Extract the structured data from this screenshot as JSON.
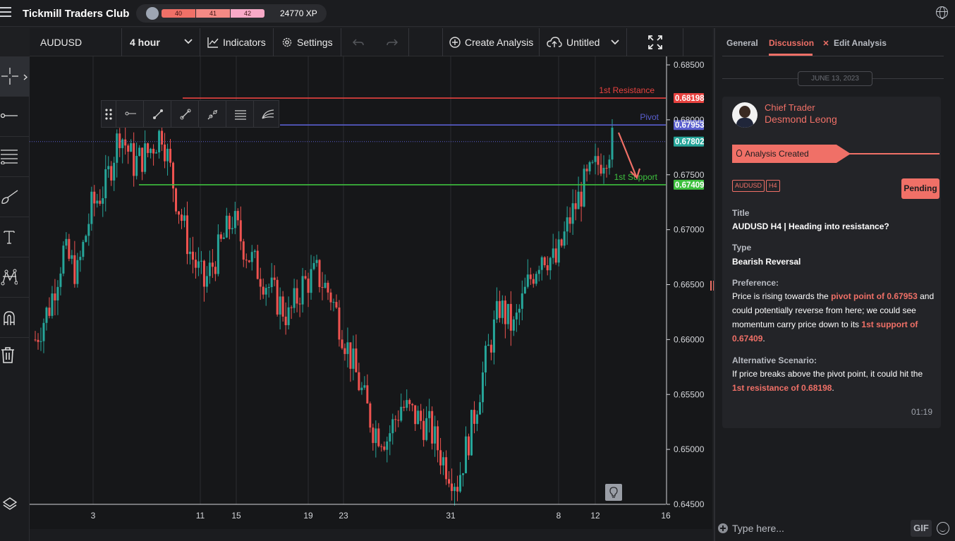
{
  "app": {
    "brand": "Tickmill Traders Club",
    "xp_levels": [
      "40",
      "41",
      "42"
    ],
    "xp_total": "24770 XP",
    "menu_icon": "hamburger-icon",
    "globe_icon": "globe-icon"
  },
  "toolbar": {
    "symbol": "AUDUSD",
    "interval": "4 hour",
    "indicators": "Indicators",
    "settings": "Settings",
    "create_analysis": "Create Analysis",
    "layout_name": "Untitled"
  },
  "left_tools": [
    "crosshair-icon",
    "horizontal-line-icon",
    "fib-lines-icon",
    "brush-icon",
    "text-icon",
    "pattern-icon",
    "magnet-icon",
    "trash-icon",
    "layers-icon"
  ],
  "chart_data": {
    "type": "candlestick",
    "symbol": "AUDUSD",
    "interval": "4 hour",
    "x_ticks": [
      "3",
      "11",
      "15",
      "19",
      "23",
      "31",
      "8",
      "12",
      "16"
    ],
    "y_ticks": [
      "0.68500",
      "0.68000",
      "0.67500",
      "0.67000",
      "0.66500",
      "0.66000",
      "0.65500",
      "0.65000",
      "0.64500"
    ],
    "ylim": [
      0.645,
      0.685
    ],
    "horizontal_levels": [
      {
        "label": "1st Resistance",
        "value": "0.68198",
        "color": "#e8423f"
      },
      {
        "label": "Pivot",
        "value": "0.67953",
        "color": "#5a5fd0"
      },
      {
        "label": "",
        "value": "0.67802",
        "color": "#26a69a"
      },
      {
        "label": "1st Support",
        "value": "0.67409",
        "color": "#3ec13e"
      }
    ],
    "up_color": "#26a69a",
    "down_color": "#ef5350",
    "close_approx": [
      0.66,
      0.663,
      0.668,
      0.666,
      0.672,
      0.674,
      0.679,
      0.676,
      0.677,
      0.679,
      0.673,
      0.668,
      0.665,
      0.668,
      0.671,
      0.668,
      0.666,
      0.664,
      0.662,
      0.665,
      0.666,
      0.664,
      0.66,
      0.656,
      0.652,
      0.651,
      0.654,
      0.653,
      0.652,
      0.649,
      0.647,
      0.652,
      0.658,
      0.663,
      0.661,
      0.665,
      0.668,
      0.667,
      0.671,
      0.674,
      0.676,
      0.678
    ]
  },
  "tabs": {
    "general": "General",
    "discussion": "Discussion",
    "edit": "Edit Analysis"
  },
  "post": {
    "date": "JUNE 13, 2023",
    "role": "Chief Trader",
    "author": "Desmond Leong",
    "status_banner": "Analysis Created",
    "tags": [
      "AUDUSD",
      "H4"
    ],
    "state": "Pending",
    "title_label": "Title",
    "title": "AUDUSD H4 | Heading into resistance?",
    "type_label": "Type",
    "type": "Bearish Reversal",
    "pref_label": "Preference:",
    "pref_a": "Price is rising towards the ",
    "pref_b": "pivot point of 0.67953",
    "pref_c": " and could potentially reverse from here; we could see momentum carry price down to its ",
    "pref_d": "1st support of 0.67409",
    "pref_e": ".",
    "alt_label": "Alternative Scenario:",
    "alt_a": "If price breaks above the pivot point, it could hit the ",
    "alt_b": "1st resistance of 0.68198",
    "alt_c": ".",
    "time": "01:19"
  },
  "compose": {
    "placeholder": "Type here...",
    "gif": "GIF"
  }
}
